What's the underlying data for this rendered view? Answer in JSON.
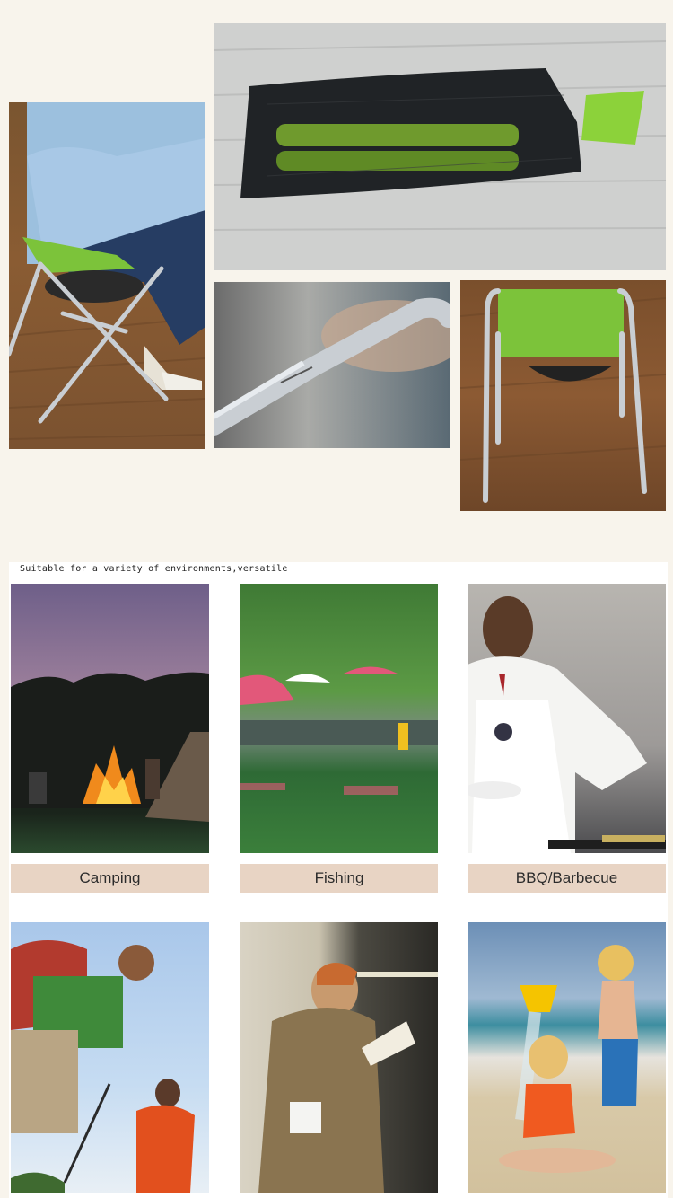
{
  "tagline": "Suitable for a variety of environments,versatile",
  "uses": [
    {
      "label": "Camping"
    },
    {
      "label": "Fishing"
    },
    {
      "label": "BBQ/Barbecue"
    }
  ],
  "colors": {
    "background": "#f8f4ec",
    "label_bg": "#e8d4c4",
    "stool_green": "#7cc33a",
    "frame_silver": "#c9ced3"
  }
}
